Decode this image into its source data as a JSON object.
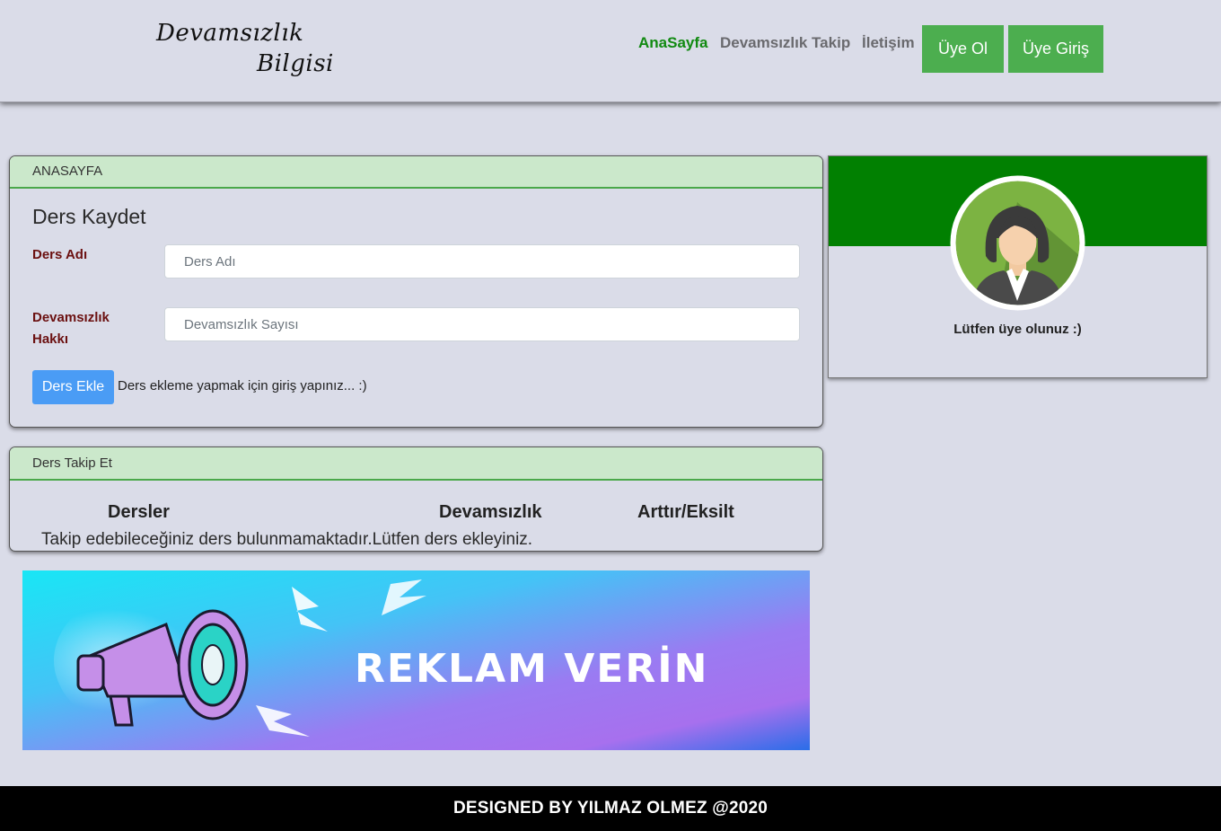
{
  "header": {
    "logo_line1": "Devamsızlık",
    "logo_line2": "Bilgisi",
    "nav": {
      "home": "AnaSayfa",
      "track": "Devamsızlık Takip",
      "contact": "İletişim"
    },
    "register_button": "Üye Ol",
    "login_button": "Üye Giriş"
  },
  "home_card": {
    "header": "ANASAYFA",
    "title": "Ders Kaydet",
    "course_name_label": "Ders Adı",
    "course_name_placeholder": "Ders Adı",
    "absence_label": "Devamsızlık Hakkı",
    "absence_placeholder": "Devamsızlık Sayısı",
    "add_button": "Ders Ekle",
    "add_note": "Ders ekleme yapmak için giriş yapınız... :)"
  },
  "track_card": {
    "header": "Ders Takip Et",
    "columns": [
      "Dersler",
      "Devamsızlık",
      "Arttır/Eksilt"
    ],
    "empty_message": "Takip edebileceğiniz ders bulunmamaktadır.Lütfen ders ekleyiniz."
  },
  "profile": {
    "avatar_icon": "businesswoman-avatar-icon",
    "message": "Lütfen üye olunuz :)"
  },
  "ad_banner": {
    "text": "REKLAM VERİN",
    "icon": "megaphone-icon"
  },
  "footer": {
    "text": "DESIGNED BY YILMAZ OLMEZ @2020"
  },
  "colors": {
    "page_bg": "#dadce8",
    "nav_active": "#118a11",
    "green_button": "#4cae4f",
    "card_header_bg": "#cbe8cb",
    "profile_banner": "#018001",
    "label_text": "#6b1010",
    "add_button": "#4a9cf5",
    "footer_bg": "#000000"
  }
}
